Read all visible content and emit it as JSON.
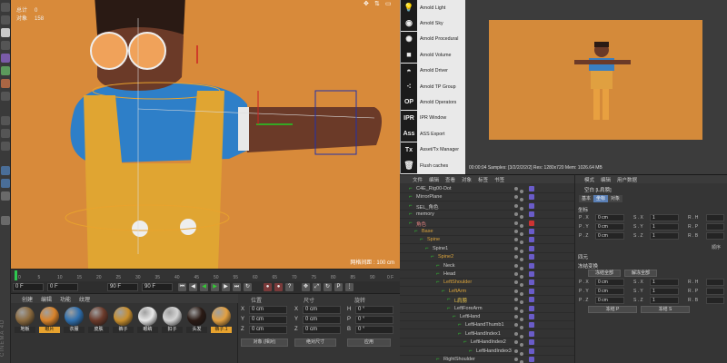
{
  "hud": {
    "select_label": "总计",
    "select_value": "0",
    "objects_label": "对象",
    "objects_value": "158"
  },
  "viewport": {
    "grid_distance": "网格间距 : 100 cm"
  },
  "timeline": {
    "ticks": [
      "0",
      "5",
      "10",
      "15",
      "20",
      "25",
      "30",
      "35",
      "40",
      "45",
      "50",
      "55",
      "60",
      "65",
      "70",
      "75",
      "80",
      "85",
      "90"
    ],
    "end_frame": "0 F"
  },
  "time_controls": {
    "start": "0 F",
    "current": "0 F",
    "end": "90 F",
    "end2": "90 F"
  },
  "materials": {
    "menu": [
      "创建",
      "编辑",
      "功能",
      "纹理"
    ],
    "swatches": [
      {
        "label": "地板",
        "color": "#8b6a3e",
        "selected": false
      },
      {
        "label": "眼片",
        "color": "#d9832a",
        "selected": true
      },
      {
        "label": "衣服",
        "color": "#2e6fae",
        "selected": false
      },
      {
        "label": "皮肤",
        "color": "#6b3a2a",
        "selected": false
      },
      {
        "label": "裤子",
        "color": "#c98f2d",
        "selected": false
      },
      {
        "label": "眼睛",
        "color": "#e8e8e8",
        "selected": false
      },
      {
        "label": "扣子",
        "color": "#d5d5d5",
        "selected": false
      },
      {
        "label": "头发",
        "color": "#2a1a14",
        "selected": false
      },
      {
        "label": "裤子.1",
        "color": "#e3a041",
        "selected": true
      }
    ]
  },
  "coordinates": {
    "headers": [
      "位置",
      "尺寸",
      "旋转"
    ],
    "rows": [
      {
        "axis": "X",
        "pos": "0 cm",
        "size_axis": "X",
        "size": "0 cm",
        "rot_axis": "H",
        "rot": "0 °"
      },
      {
        "axis": "Y",
        "pos": "0 cm",
        "size_axis": "Y",
        "size": "0 cm",
        "rot_axis": "P",
        "rot": "0 °"
      },
      {
        "axis": "Z",
        "pos": "0 cm",
        "size_axis": "Z",
        "size": "0 cm",
        "rot_axis": "B",
        "rot": "0 °"
      }
    ],
    "mode_select": "对象 (相对)",
    "size_select": "绝对尺寸",
    "apply_button": "应用"
  },
  "plugins": [
    {
      "icon": "bulb",
      "label": "Arnold Light"
    },
    {
      "icon": "globe",
      "label": "Arnold Sky"
    },
    {
      "icon": "gear",
      "label": "Arnold Procedural"
    },
    {
      "icon": "cube",
      "label": "Arnold Volume"
    },
    {
      "icon": "dome",
      "label": "Arnold Driver"
    },
    {
      "icon": "dots",
      "label": "Arnold TP Group"
    },
    {
      "icon": "OP",
      "label": "Arnold Operators"
    },
    {
      "icon": "IPR",
      "label": "IPR Window"
    },
    {
      "icon": "Ass",
      "label": "ASS Export"
    },
    {
      "icon": "Tx",
      "label": "Asset/Tx Manager"
    },
    {
      "icon": "trash",
      "label": "Flush caches"
    }
  ],
  "render_status": "00:00:04  Samples: [3/2/2/2/2/2]  Res: 1280x720  Mem: 1026.64 MB",
  "object_manager": {
    "menu": [
      "文件",
      "编辑",
      "查看",
      "对象",
      "标签",
      "书签"
    ],
    "rows": [
      {
        "name": "C4E_Rig00-Dot",
        "indent": 0,
        "color": "#ccc"
      },
      {
        "name": "MirrorPlane",
        "indent": 0,
        "color": "#ccc"
      },
      {
        "name": "SEL_角色",
        "indent": 0,
        "color": "#ccc"
      },
      {
        "name": "memory",
        "indent": 0,
        "color": "#ccc"
      },
      {
        "name": "角色",
        "indent": 0,
        "color": "#e07f7f"
      },
      {
        "name": "Base",
        "indent": 1,
        "color": "#d9a23a"
      },
      {
        "name": "Spine",
        "indent": 2,
        "color": "#d9a23a"
      },
      {
        "name": "Spine1",
        "indent": 3,
        "color": "#ccc"
      },
      {
        "name": "Spine2",
        "indent": 4,
        "color": "#d9a23a"
      },
      {
        "name": "Neck",
        "indent": 5,
        "color": "#ccc"
      },
      {
        "name": "Head",
        "indent": 5,
        "color": "#ccc"
      },
      {
        "name": "LeftShoulder",
        "indent": 5,
        "color": "#d9a23a"
      },
      {
        "name": "LeftArm",
        "indent": 6,
        "color": "#d9a23a"
      },
      {
        "name": "L肩膀",
        "indent": 7,
        "color": "#e3c04a"
      },
      {
        "name": "LeftForeArm",
        "indent": 7,
        "color": "#ccc"
      },
      {
        "name": "LeftHand",
        "indent": 8,
        "color": "#ccc"
      },
      {
        "name": "LeftHandThumb1",
        "indent": 9,
        "color": "#ccc"
      },
      {
        "name": "LeftHandIndex1",
        "indent": 9,
        "color": "#ccc"
      },
      {
        "name": "LeftHandIndex2",
        "indent": 10,
        "color": "#ccc"
      },
      {
        "name": "LeftHandIndex3",
        "indent": 11,
        "color": "#ccc"
      },
      {
        "name": "RightShoulder",
        "indent": 5,
        "color": "#ccc"
      }
    ]
  },
  "attributes": {
    "menu": [
      "模式",
      "编辑",
      "用户数据"
    ],
    "object_title": "空白 [L肩膀]",
    "tabs": [
      "基本",
      "坐标",
      "对象"
    ],
    "section_coord": "坐标",
    "section_frozen": "冻结变换",
    "section_quaternion": "四元",
    "pos_rows": [
      {
        "p": "P . X",
        "pv": "0 cm",
        "s": "S . X",
        "sv": "1",
        "r": "R . H"
      },
      {
        "p": "P . Y",
        "pv": "0 cm",
        "s": "S . Y",
        "sv": "1",
        "r": "R . P"
      },
      {
        "p": "P . Z",
        "pv": "0 cm",
        "s": "S . Z",
        "sv": "1",
        "r": "R . B"
      }
    ],
    "order_label": "顺序",
    "freeze_all": "冻结全部",
    "unfreeze_all": "解冻全部",
    "frozen_rows": [
      {
        "p": "P . X",
        "pv": "0 cm",
        "s": "S . X",
        "sv": "1",
        "r": "R . H"
      },
      {
        "p": "P . Y",
        "pv": "0 cm",
        "s": "S . Y",
        "sv": "1",
        "r": "R . P"
      },
      {
        "p": "P . Z",
        "pv": "0 cm",
        "s": "S . Z",
        "sv": "1",
        "r": "R . B"
      }
    ],
    "freeze_p": "冻结 P",
    "freeze_s": "冻结 S"
  },
  "colors": {
    "accent": "#e8a32e",
    "viewport_bg": "#d88a3a",
    "shirt": "#2e7fc8",
    "overalls": "#e0a532",
    "skin": "#6b3a28"
  }
}
